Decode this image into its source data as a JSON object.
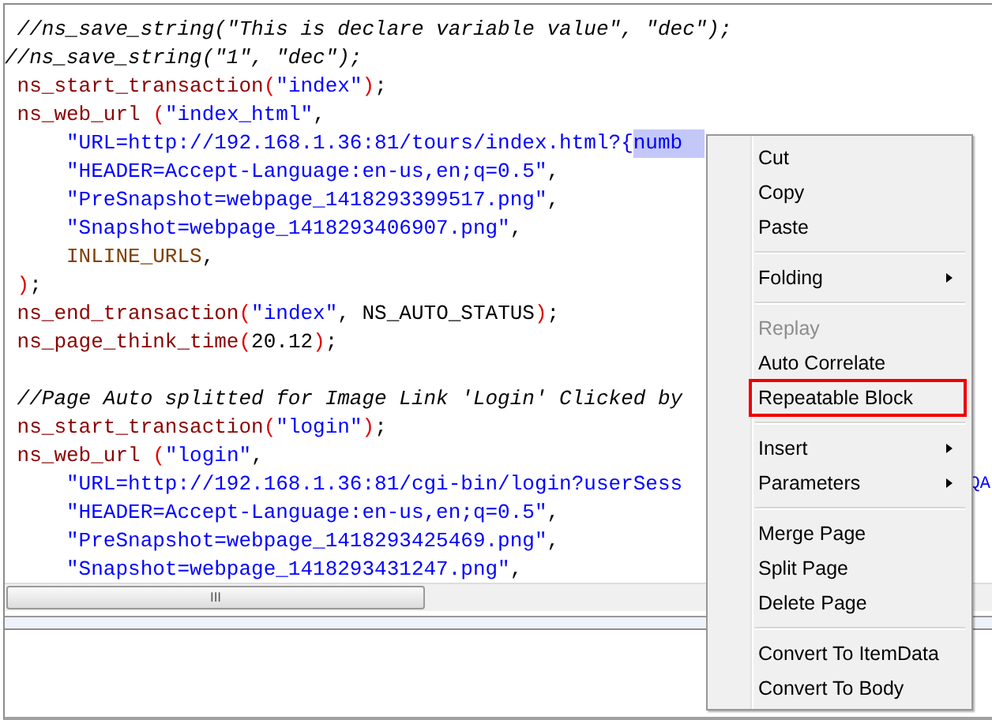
{
  "editor": {
    "blocks": [
      {
        "lines": [
          {
            "segments": [
              {
                "kind": "comment",
                "text": " //ns_save_string(\"This is declare variable value\", \"dec\");"
              }
            ]
          },
          {
            "segments": [
              {
                "kind": "comment",
                "text": "//ns_save_string(\"1\", \"dec\");"
              }
            ]
          },
          {
            "segments": [
              {
                "kind": "func",
                "text": " ns_start_transaction"
              },
              {
                "kind": "paren",
                "text": "("
              },
              {
                "kind": "string",
                "text": "\"index\""
              },
              {
                "kind": "paren",
                "text": ")"
              },
              {
                "kind": "plain",
                "text": ";"
              }
            ]
          },
          {
            "segments": [
              {
                "kind": "func",
                "text": " ns_web_url "
              },
              {
                "kind": "paren",
                "text": "("
              },
              {
                "kind": "string",
                "text": "\"index_html\""
              },
              {
                "kind": "plain",
                "text": ","
              }
            ]
          },
          {
            "segments": [
              {
                "kind": "string",
                "text": "     \"URL=http://192.168.1.36:81/tours/index.html?{"
              },
              {
                "kind": "selection",
                "text": "numb"
              }
            ]
          },
          {
            "segments": [
              {
                "kind": "string",
                "text": "     \"HEADER=Accept-Language:en-us,en;q=0.5\""
              },
              {
                "kind": "plain",
                "text": ","
              }
            ]
          },
          {
            "segments": [
              {
                "kind": "string",
                "text": "     \"PreSnapshot=webpage_1418293399517.png\""
              },
              {
                "kind": "plain",
                "text": ","
              }
            ]
          },
          {
            "segments": [
              {
                "kind": "string",
                "text": "     \"Snapshot=webpage_1418293406907.png\""
              },
              {
                "kind": "plain",
                "text": ","
              }
            ]
          },
          {
            "segments": [
              {
                "kind": "constant",
                "text": "     INLINE_URLS"
              },
              {
                "kind": "plain",
                "text": ","
              }
            ]
          },
          {
            "segments": [
              {
                "kind": "paren",
                "text": " )"
              },
              {
                "kind": "plain",
                "text": ";"
              }
            ]
          },
          {
            "segments": [
              {
                "kind": "func",
                "text": " ns_end_transaction"
              },
              {
                "kind": "paren",
                "text": "("
              },
              {
                "kind": "string",
                "text": "\"index\""
              },
              {
                "kind": "plain",
                "text": ", NS_AUTO_STATUS"
              },
              {
                "kind": "paren",
                "text": ")"
              },
              {
                "kind": "plain",
                "text": ";"
              }
            ]
          },
          {
            "segments": [
              {
                "kind": "func",
                "text": " ns_page_think_time"
              },
              {
                "kind": "paren",
                "text": "("
              },
              {
                "kind": "plain",
                "text": "20.12"
              },
              {
                "kind": "paren",
                "text": ")"
              },
              {
                "kind": "plain",
                "text": ";"
              }
            ]
          }
        ]
      },
      {
        "lines": [
          {
            "segments": [
              {
                "kind": "comment",
                "text": " //Page Auto splitted for Image Link 'Login' Clicked by"
              }
            ]
          },
          {
            "segments": [
              {
                "kind": "func",
                "text": " ns_start_transaction"
              },
              {
                "kind": "paren",
                "text": "("
              },
              {
                "kind": "string",
                "text": "\"login\""
              },
              {
                "kind": "paren",
                "text": ")"
              },
              {
                "kind": "plain",
                "text": ";"
              }
            ]
          },
          {
            "segments": [
              {
                "kind": "func",
                "text": " ns_web_url "
              },
              {
                "kind": "paren",
                "text": "("
              },
              {
                "kind": "string",
                "text": "\"login\""
              },
              {
                "kind": "plain",
                "text": ","
              }
            ]
          },
          {
            "segments": [
              {
                "kind": "string",
                "text": "     \"URL=http://192.168.1.36:81/cgi-bin/login?userSess"
              }
            ],
            "tail": "QA"
          },
          {
            "segments": [
              {
                "kind": "string",
                "text": "     \"HEADER=Accept-Language:en-us,en;q=0.5\""
              },
              {
                "kind": "plain",
                "text": ","
              }
            ]
          },
          {
            "segments": [
              {
                "kind": "string",
                "text": "     \"PreSnapshot=webpage_1418293425469.png\""
              },
              {
                "kind": "plain",
                "text": ","
              }
            ]
          },
          {
            "segments": [
              {
                "kind": "string",
                "text": "     \"Snapshot=webpage_1418293431247.png\""
              },
              {
                "kind": "plain",
                "text": ","
              }
            ]
          }
        ]
      }
    ],
    "scrollbar_grip": "III"
  },
  "context_menu": {
    "items": [
      {
        "kind": "item",
        "label": "Cut",
        "disabled": false,
        "submenu": false,
        "outlined": false
      },
      {
        "kind": "item",
        "label": "Copy",
        "disabled": false,
        "submenu": false,
        "outlined": false
      },
      {
        "kind": "item",
        "label": "Paste",
        "disabled": false,
        "submenu": false,
        "outlined": false
      },
      {
        "kind": "separator"
      },
      {
        "kind": "item",
        "label": "Folding",
        "disabled": false,
        "submenu": true,
        "outlined": false
      },
      {
        "kind": "separator"
      },
      {
        "kind": "item",
        "label": "Replay",
        "disabled": true,
        "submenu": false,
        "outlined": false
      },
      {
        "kind": "item",
        "label": "Auto Correlate",
        "disabled": false,
        "submenu": false,
        "outlined": false
      },
      {
        "kind": "item",
        "label": "Repeatable Block",
        "disabled": false,
        "submenu": false,
        "outlined": true
      },
      {
        "kind": "separator"
      },
      {
        "kind": "item",
        "label": "Insert",
        "disabled": false,
        "submenu": true,
        "outlined": false
      },
      {
        "kind": "item",
        "label": "Parameters",
        "disabled": false,
        "submenu": true,
        "outlined": false
      },
      {
        "kind": "separator"
      },
      {
        "kind": "item",
        "label": "Merge Page",
        "disabled": false,
        "submenu": false,
        "outlined": false
      },
      {
        "kind": "item",
        "label": "Split Page",
        "disabled": false,
        "submenu": false,
        "outlined": false
      },
      {
        "kind": "item",
        "label": "Delete Page",
        "disabled": false,
        "submenu": false,
        "outlined": false
      },
      {
        "kind": "separator"
      },
      {
        "kind": "item",
        "label": "Convert To ItemData",
        "disabled": false,
        "submenu": false,
        "outlined": false
      },
      {
        "kind": "item",
        "label": "Convert To Body",
        "disabled": false,
        "submenu": false,
        "outlined": false
      }
    ]
  }
}
